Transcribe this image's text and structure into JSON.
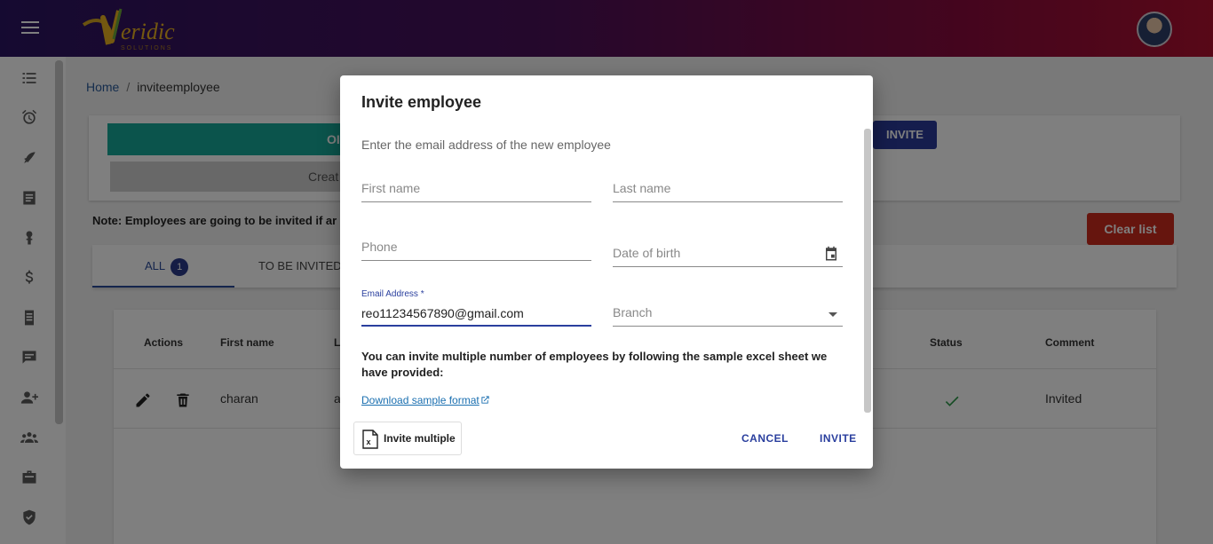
{
  "header": {
    "logo_text": "Veridic",
    "logo_sub": "SOLUTIONS"
  },
  "sidebar": {
    "icons": [
      "checklist-icon",
      "alarm-clock-icon",
      "dolphin-icon",
      "list-icon",
      "money-icon",
      "dollar-icon",
      "document-icon",
      "chat-icon",
      "add-user-icon",
      "group-icon",
      "briefcase-icon",
      "shield-icon"
    ]
  },
  "breadcrumb": {
    "home": "Home",
    "separator": "/",
    "current": "inviteemployee"
  },
  "top_card": {
    "teal_label": "OI",
    "grey_label": "Creat",
    "invite_label": "INVITE"
  },
  "note": "Note: Employees are going to be invited if ar",
  "clear_list": "Clear list",
  "tabs": {
    "all": "ALL",
    "all_count": "1",
    "to_be_invited": "TO BE INVITED"
  },
  "table": {
    "headers": {
      "actions": "Actions",
      "first_name": "First name",
      "last_name_partial": "L",
      "status": "Status",
      "comment": "Comment"
    },
    "rows": [
      {
        "first_name": "charan",
        "last_name_partial": "a",
        "comment": "Invited"
      }
    ]
  },
  "dialog": {
    "title": "Invite employee",
    "subtitle": "Enter the email address of the new employee",
    "first_name": "First name",
    "last_name": "Last name",
    "phone": "Phone",
    "dob": "Date of birth",
    "email_label": "Email Address *",
    "email_value": "reo11234567890@gmail.com",
    "branch": "Branch",
    "multi_note": "You can invite multiple number of employees by following the sample excel sheet we have provided:",
    "download_link": "Download sample format",
    "invite_multiple": "Invite multiple",
    "cancel": "CANCEL",
    "invite": "INVITE"
  },
  "colors": {
    "accent": "#2a3f9e",
    "teal": "#17a899",
    "danger": "#cc2a1c"
  }
}
